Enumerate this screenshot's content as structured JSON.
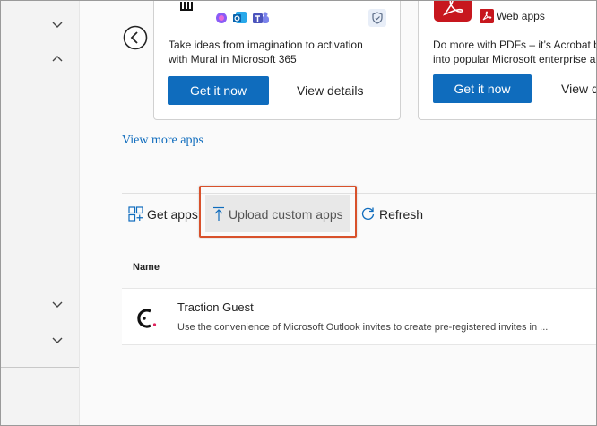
{
  "apps": {
    "card1": {
      "description_line1": "Take ideas from imagination to activation",
      "description_line2": "with Mural in Microsoft 365",
      "primary_label": "Get it now",
      "secondary_label": "View details"
    },
    "card2": {
      "tag": "Web apps",
      "description_line1": "Do more with PDFs – it’s Acrobat b",
      "description_line2": "into popular Microsoft enterprise a",
      "primary_label": "Get it now",
      "secondary_label": "View d"
    },
    "view_more": "View more apps"
  },
  "toolbar": {
    "get_apps": "Get apps",
    "upload": "Upload custom apps",
    "refresh": "Refresh"
  },
  "table": {
    "header_name": "Name",
    "rows": [
      {
        "title": "Traction Guest",
        "description": "Use the convenience of Microsoft Outlook invites to create pre-registered invites in ..."
      }
    ]
  },
  "colors": {
    "accent": "#0f6cbd",
    "highlight": "#d8512b",
    "acrobat": "#c7171e"
  },
  "icons": [
    "chevron-down-icon",
    "chevron-up-icon",
    "back-arrow-icon",
    "copilot-icon",
    "outlook-icon",
    "teams-icon",
    "shield-icon",
    "acrobat-icon",
    "grid-icon",
    "upload-icon",
    "refresh-icon",
    "traction-logo-icon"
  ]
}
